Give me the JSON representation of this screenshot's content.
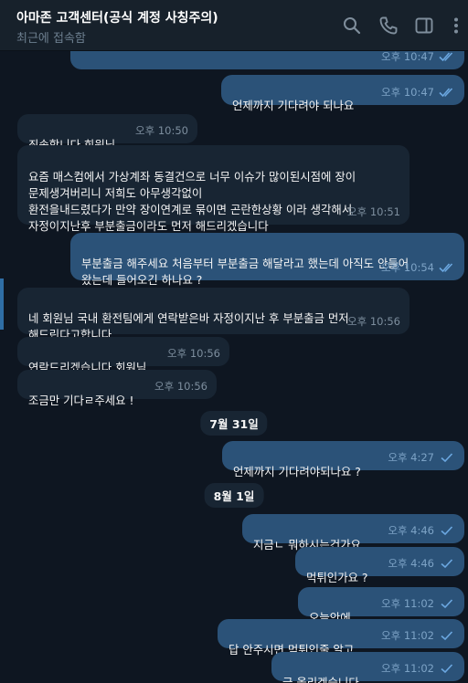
{
  "header": {
    "title": "아마존 고객센터(공식 계정 사칭주의)",
    "status": "최근에 접속함",
    "icons": [
      "search-icon",
      "phone-icon",
      "sidebar-toggle-icon",
      "more-vertical-icon"
    ]
  },
  "messages": [
    {
      "direction": "out",
      "text": "",
      "time": "오후 10:47",
      "read": true
    },
    {
      "direction": "out",
      "text": "언제까지 기다려야 되나요",
      "time": "오후 10:47",
      "read": true
    },
    {
      "direction": "in",
      "text": "죄송합니다 회원님",
      "time": "오후 10:50"
    },
    {
      "direction": "in",
      "text": "요즘 매스컴에서 가상계좌 동결건으로 너무 이슈가 많이된시점에 장이\n문제생겨버리니 저희도 아무생각없이\n 환전을내드렸다가 만약 장이연계로 묶이면 곤란한상황 이라 생각해서\n자정이지난후 부분출금이라도 먼저 해드리겠습니다",
      "time": "오후 10:51"
    },
    {
      "direction": "out",
      "text": "부분출금 해주세요 처음부터 부분출금 해달라고 했는데 아직도 안들어\n왔는데 들어오긴 하나요 ?",
      "time": "오후 10:54",
      "read": true
    },
    {
      "direction": "in",
      "text": "네 회원님 국내 환전팀에게 연락받은바 자정이지난 후 부분출금 먼저\n해드린다고합니다",
      "time": "오후 10:56"
    },
    {
      "direction": "in",
      "text": "연락드리겠습니다 회원님",
      "time": "오후 10:56"
    },
    {
      "direction": "in",
      "text": "조금만 기다ㄹ주세요 !",
      "time": "오후 10:56"
    },
    {
      "direction": "date",
      "text": "7월 31일"
    },
    {
      "direction": "out",
      "text": "언제까지 기다려야되나요 ?",
      "time": "오후 4:27",
      "read": false
    },
    {
      "direction": "date",
      "text": "8월 1일"
    },
    {
      "direction": "out",
      "text": "지금ㄴ 뭐하시는건가요",
      "time": "오후 4:46",
      "read": false
    },
    {
      "direction": "out",
      "text": "먹튀인가요 ?",
      "time": "오후 4:46",
      "read": false
    },
    {
      "direction": "out",
      "text": "오늘안에",
      "time": "오후 11:02",
      "read": false
    },
    {
      "direction": "out",
      "text": "답 안주시면 먹튀인줄 알고",
      "time": "오후 11:02",
      "read": false
    },
    {
      "direction": "out",
      "text": "글 올리겠습니다",
      "time": "오후 11:02",
      "read": false
    }
  ],
  "colors": {
    "background": "#0e1621",
    "header": "#17212b",
    "incoming": "#182533",
    "outgoing": "#2b5278",
    "accent": "#2f6ea5"
  }
}
